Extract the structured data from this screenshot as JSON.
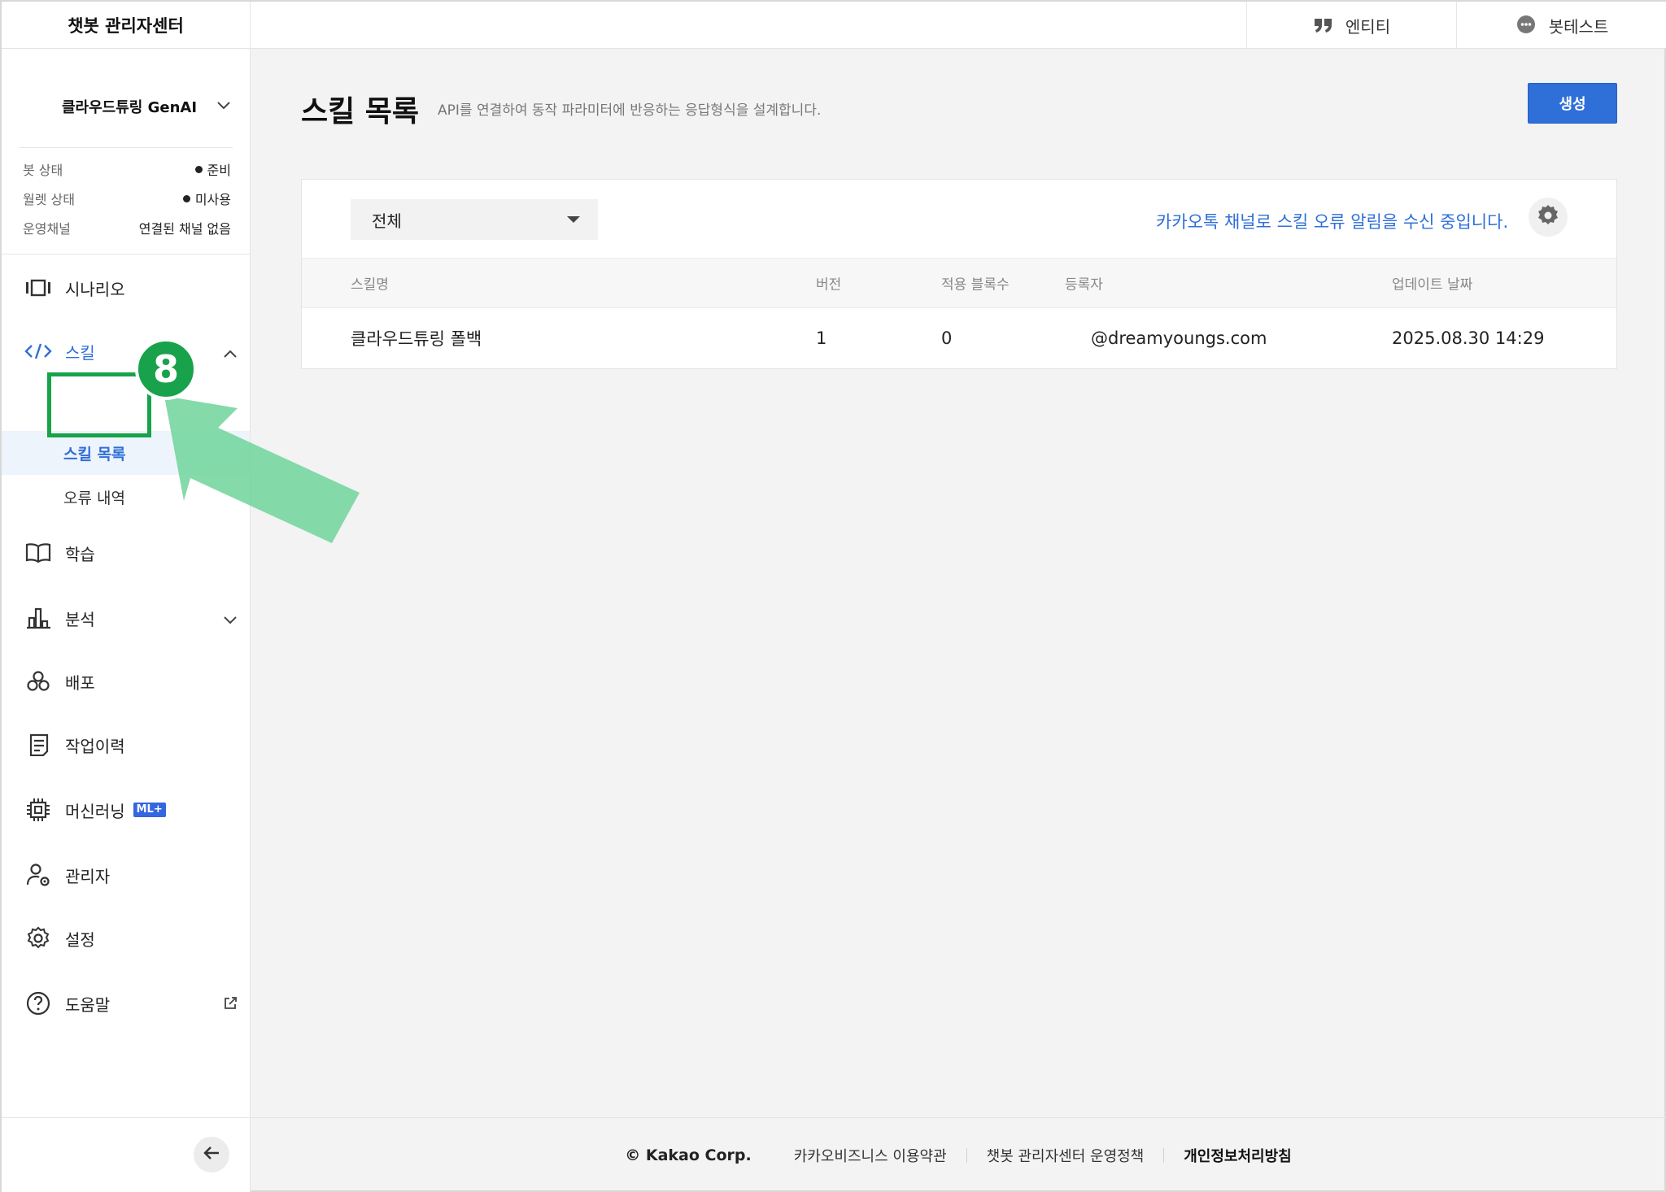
{
  "header": {
    "brand": "챗봇 관리자센터",
    "tabs": [
      {
        "label": "엔티티",
        "icon": "quote-icon"
      },
      {
        "label": "봇테스트",
        "icon": "chat-bubble-icon"
      }
    ]
  },
  "sidebar": {
    "workspace_name": "클라우드튜링 GenAI",
    "status": [
      {
        "label": "봇 상태",
        "value": "준비"
      },
      {
        "label": "월렛 상태",
        "value": "미사용"
      },
      {
        "label": "운영채널",
        "value": "연결된 채널 없음"
      }
    ],
    "items": [
      {
        "label": "시나리오",
        "icon": "scenario-icon"
      },
      {
        "label": "스킬",
        "icon": "code-icon"
      },
      {
        "label": "학습",
        "icon": "book-icon"
      },
      {
        "label": "분석",
        "icon": "bar-chart-icon"
      },
      {
        "label": "배포",
        "icon": "deploy-icon"
      },
      {
        "label": "작업이력",
        "icon": "history-icon"
      },
      {
        "label": "머신러닝",
        "icon": "chip-icon",
        "badge": "ML+"
      },
      {
        "label": "관리자",
        "icon": "admin-icon"
      },
      {
        "label": "설정",
        "icon": "gear-icon"
      },
      {
        "label": "도움말",
        "icon": "help-icon"
      }
    ],
    "sub_items": [
      {
        "label": "스킬 목록"
      },
      {
        "label": "오류 내역"
      }
    ]
  },
  "main": {
    "title": "스킬 목록",
    "description": "API를 연결하여 동작 파라미터에 반응하는 응답형식을 설계합니다.",
    "create_label": "생성",
    "filter_value": "전체",
    "notice": "카카오톡 채널로 스킬 오류 알림을 수신 중입니다.",
    "table": {
      "headers": [
        "스킬명",
        "버전",
        "적용 블록수",
        "등록자",
        "업데이트 날짜"
      ],
      "rows": [
        [
          "클라우드튜링 폴백",
          "1",
          "0",
          "@dreamyoungs.com",
          "2025.08.30 14:29"
        ]
      ]
    }
  },
  "footer": {
    "copyright": "© Kakao Corp.",
    "links": [
      "카카오비즈니스 이용약관",
      "챗봇 관리자센터 운영정책",
      "개인정보처리방침"
    ]
  },
  "annotation": {
    "step": "8"
  },
  "colors": {
    "accent": "#2f6fd8",
    "highlight": "#17a34a",
    "arrow": "#6fd39a"
  }
}
